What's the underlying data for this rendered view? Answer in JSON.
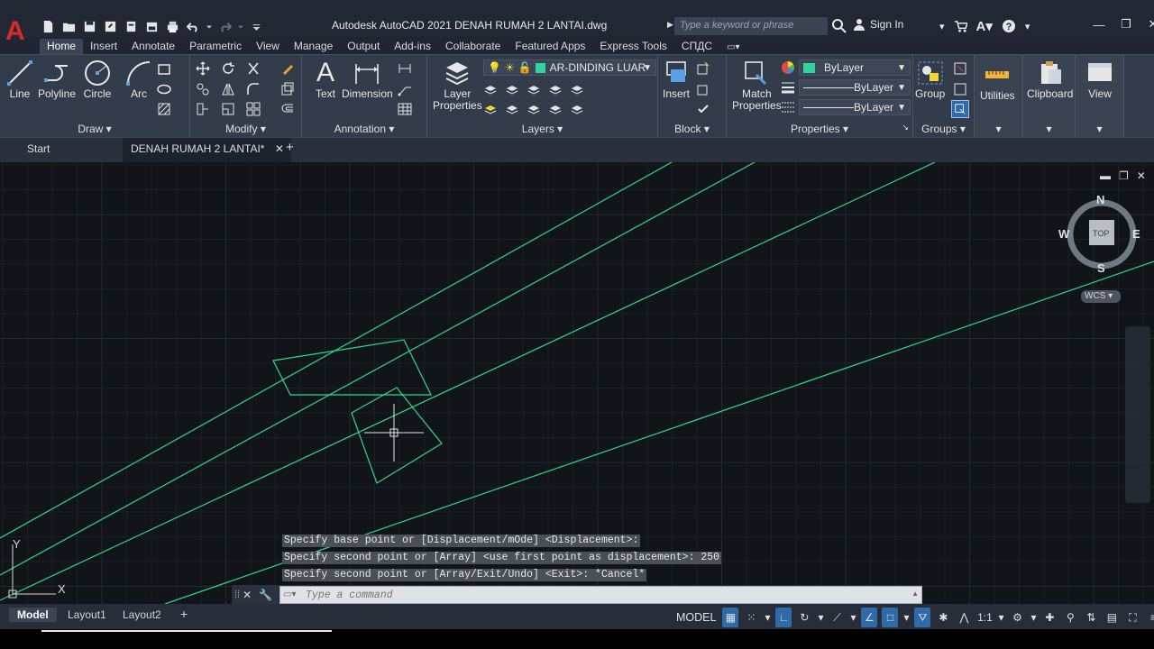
{
  "app": {
    "title": "Autodesk AutoCAD 2021    DENAH RUMAH 2 LANTAI.dwg",
    "logo": "A",
    "search_placeholder": "Type a keyword or phrase",
    "sign_in": "Sign In"
  },
  "ribbon_tabs": [
    "Home",
    "Insert",
    "Annotate",
    "Parametric",
    "View",
    "Manage",
    "Output",
    "Add-ins",
    "Collaborate",
    "Featured Apps",
    "Express Tools",
    "СПДС"
  ],
  "ribbon": {
    "draw": {
      "title": "Draw",
      "line": "Line",
      "polyline": "Polyline",
      "circle": "Circle",
      "arc": "Arc"
    },
    "modify": {
      "title": "Modify"
    },
    "annotation": {
      "title": "Annotation",
      "text": "Text",
      "dimension": "Dimension"
    },
    "layers": {
      "title": "Layers",
      "layer_properties_1": "Layer",
      "layer_properties_2": "Properties",
      "current_layer": "AR-DINDING LUAR"
    },
    "block": {
      "title": "Block",
      "insert": "Insert"
    },
    "properties": {
      "title": "Properties",
      "match_1": "Match",
      "match_2": "Properties",
      "color": "ByLayer",
      "linetype": "ByLayer",
      "lineweight": "ByLayer"
    },
    "groups": {
      "title": "Groups",
      "group": "Group"
    },
    "utilities": "Utilities",
    "clipboard": "Clipboard",
    "view": "View"
  },
  "doc_tabs": {
    "start": "Start",
    "active": "DENAH RUMAH 2 LANTAI*"
  },
  "viewcube": {
    "n": "N",
    "s": "S",
    "e": "E",
    "w": "W",
    "face": "TOP",
    "wcs": "WCS"
  },
  "ucs": {
    "x": "X",
    "y": "Y"
  },
  "command": {
    "history": [
      "Specify base point or [Displacement/mOde] <Displacement>:",
      "Specify second point or [Array] <use first point as displacement>: 250",
      "Specify second point or [Array/Exit/Undo] <Exit>: *Cancel*"
    ],
    "placeholder": "Type a command"
  },
  "layout_tabs": [
    "Model",
    "Layout1",
    "Layout2"
  ],
  "status": {
    "model": "MODEL",
    "scale": "1:1"
  },
  "colors": {
    "accent": "#2f6aa9",
    "drawing_line": "#2fd59a",
    "background": "#111418"
  }
}
